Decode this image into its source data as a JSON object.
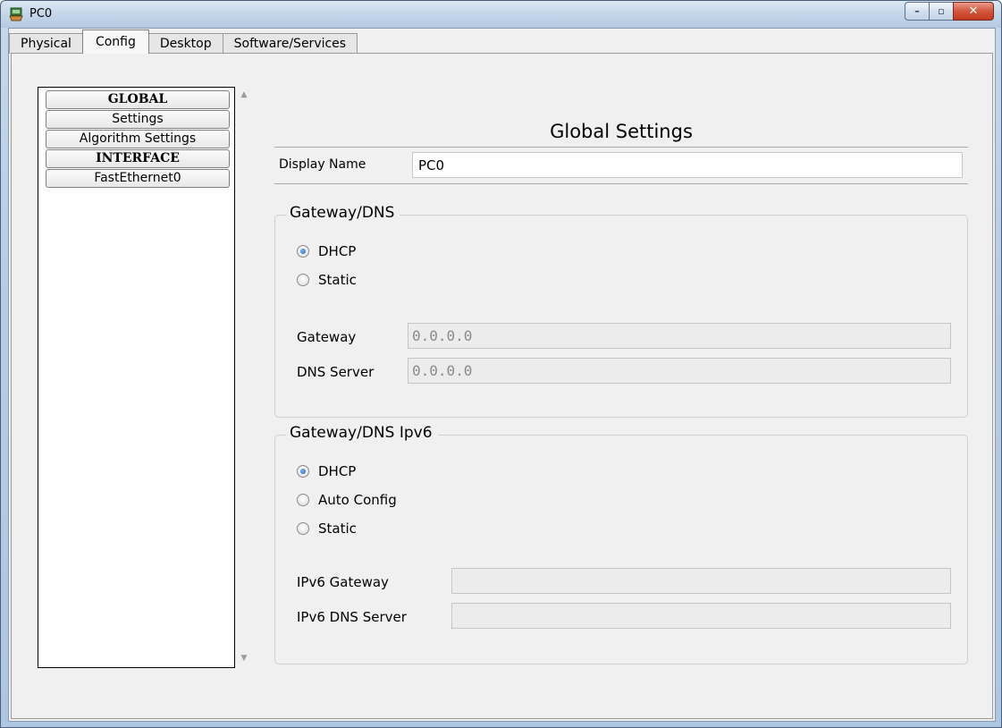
{
  "window": {
    "title": "PC0",
    "controls": {
      "minimize": "–",
      "maximize": "▫",
      "close": "✕"
    }
  },
  "tabs": [
    {
      "label": "Physical",
      "active": false
    },
    {
      "label": "Config",
      "active": true
    },
    {
      "label": "Desktop",
      "active": false
    },
    {
      "label": "Software/Services",
      "active": false
    }
  ],
  "nav": {
    "items": [
      {
        "label": "GLOBAL",
        "type": "header"
      },
      {
        "label": "Settings",
        "type": "item"
      },
      {
        "label": "Algorithm Settings",
        "type": "item"
      },
      {
        "label": "INTERFACE",
        "type": "header"
      },
      {
        "label": "FastEthernet0",
        "type": "item"
      }
    ]
  },
  "global_settings": {
    "title": "Global Settings",
    "display_name_label": "Display Name",
    "display_name_value": "PC0"
  },
  "gateway_dns": {
    "legend": "Gateway/DNS",
    "options": [
      {
        "label": "DHCP",
        "checked": true
      },
      {
        "label": "Static",
        "checked": false
      }
    ],
    "gateway_label": "Gateway",
    "gateway_value": "0.0.0.0",
    "dns_label": "DNS Server",
    "dns_value": "0.0.0.0"
  },
  "gateway_dns_ipv6": {
    "legend": "Gateway/DNS Ipv6",
    "options": [
      {
        "label": "DHCP",
        "checked": true
      },
      {
        "label": "Auto Config",
        "checked": false
      },
      {
        "label": "Static",
        "checked": false
      }
    ],
    "gateway_label": "IPv6 Gateway",
    "gateway_value": "",
    "dns_label": "IPv6 DNS Server",
    "dns_value": ""
  },
  "colors": {
    "title_bar": "#c4d6ea",
    "close_button": "#d4563d",
    "radio_checked": "#1d5fae"
  }
}
